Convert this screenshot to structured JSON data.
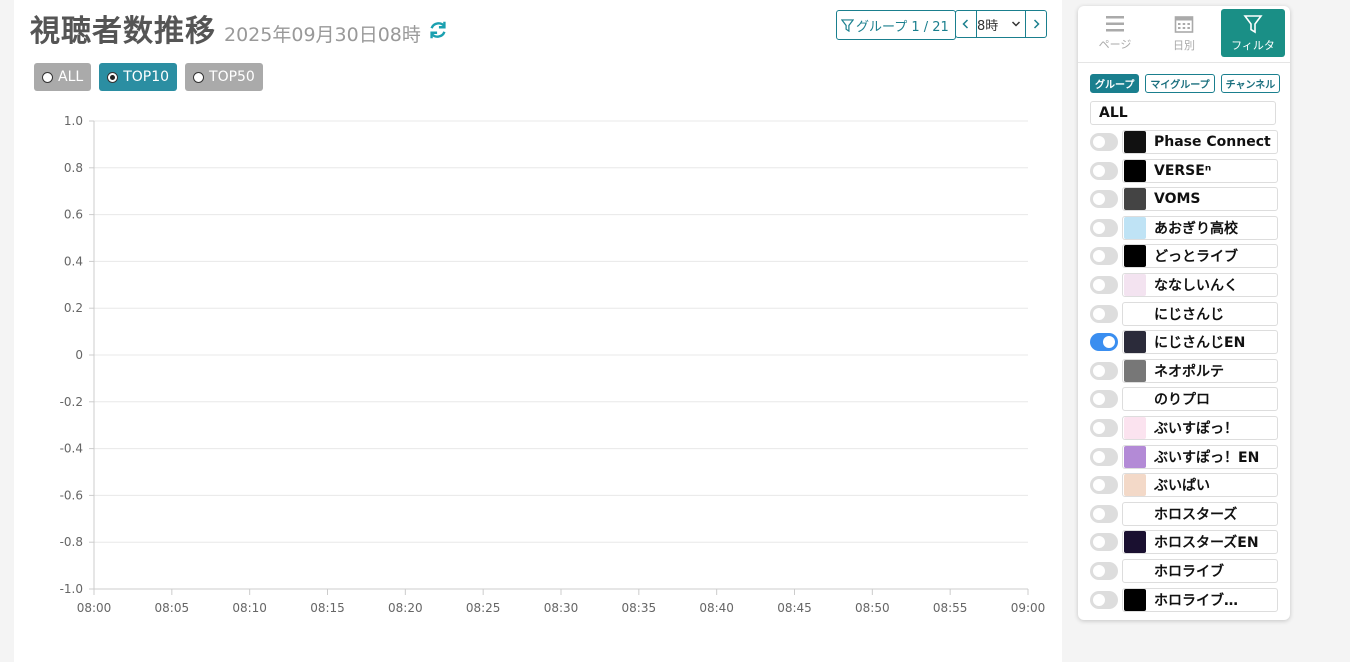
{
  "header": {
    "title": "視聴者数推移",
    "datetime": "2025年09月30日08時",
    "group_button": "グループ 1 / 21",
    "hour": "8時"
  },
  "radios": [
    {
      "label": "ALL",
      "active": false
    },
    {
      "label": "TOP10",
      "active": true
    },
    {
      "label": "TOP50",
      "active": false
    }
  ],
  "chart_data": {
    "type": "line",
    "series": [],
    "x": [
      "08:00",
      "08:05",
      "08:10",
      "08:15",
      "08:20",
      "08:25",
      "08:30",
      "08:35",
      "08:40",
      "08:45",
      "08:50",
      "08:55",
      "09:00"
    ],
    "y_ticks": [
      "1.0",
      "0.8",
      "0.6",
      "0.4",
      "0.2",
      "0",
      "-0.2",
      "-0.4",
      "-0.6",
      "-0.8",
      "-1.0"
    ],
    "ylim": [
      -1.0,
      1.0
    ],
    "grid": true
  },
  "panel": {
    "tabs": [
      {
        "label": "ページ",
        "icon": "menu-icon",
        "active": false
      },
      {
        "label": "日別",
        "icon": "calendar-icon",
        "active": false
      },
      {
        "label": "フィルタ",
        "icon": "filter-icon",
        "active": true
      }
    ],
    "chips": [
      {
        "label": "グループ",
        "active": true
      },
      {
        "label": "マイグループ",
        "active": false
      },
      {
        "label": "チャンネル",
        "active": false
      }
    ],
    "all_label": "ALL",
    "items": [
      {
        "name": "Phase Connect",
        "on": false,
        "logo_color": "#111111"
      },
      {
        "name": "VERSEⁿ",
        "on": false,
        "logo_color": "#000000"
      },
      {
        "name": "VOMS",
        "on": false,
        "logo_color": "#444444"
      },
      {
        "name": "あおぎり高校",
        "on": false,
        "logo_color": "#bfe3f5"
      },
      {
        "name": "どっとライブ",
        "on": false,
        "logo_color": "#000000"
      },
      {
        "name": "ななしいんく",
        "on": false,
        "logo_color": "#f3e3f0"
      },
      {
        "name": "にじさんじ",
        "on": false,
        "logo_color": "#ffffff"
      },
      {
        "name": "にじさんじEN",
        "on": true,
        "logo_color": "#2b2b3a"
      },
      {
        "name": "ネオポルテ",
        "on": false,
        "logo_color": "#777777"
      },
      {
        "name": "のりプロ",
        "on": false,
        "logo_color": "#ffffff"
      },
      {
        "name": "ぶいすぽっ！",
        "on": false,
        "logo_color": "#fbe3ef"
      },
      {
        "name": "ぶいすぽっ！EN",
        "on": false,
        "logo_color": "#b38ad6"
      },
      {
        "name": "ぶいぱい",
        "on": false,
        "logo_color": "#f3d9c8"
      },
      {
        "name": "ホロスターズ",
        "on": false,
        "logo_color": "#ffffff"
      },
      {
        "name": "ホロスターズEN",
        "on": false,
        "logo_color": "#1a1030"
      },
      {
        "name": "ホロライブ",
        "on": false,
        "logo_color": "#ffffff"
      },
      {
        "name": "ホロライブ…",
        "on": false,
        "logo_color": "#000000"
      }
    ]
  }
}
